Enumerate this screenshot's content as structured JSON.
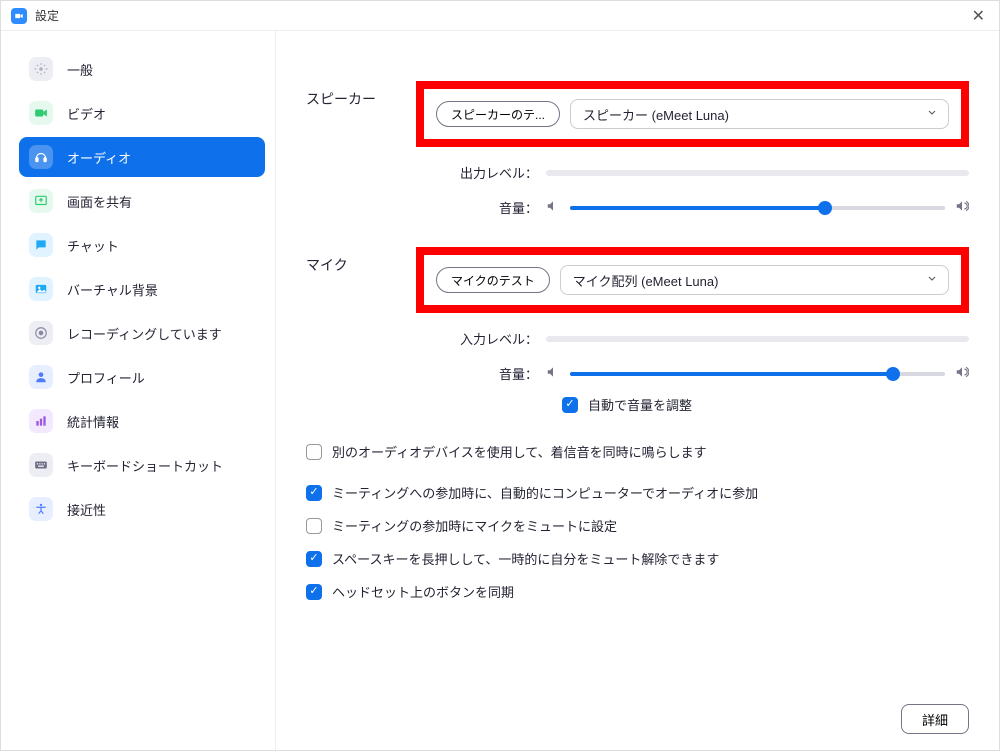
{
  "window": {
    "title": "設定"
  },
  "sidebar": {
    "items": [
      {
        "id": "general",
        "label": "一般",
        "iconBg": "#EDEDF4",
        "iconColor": "#B0B0BE"
      },
      {
        "id": "video",
        "label": "ビデオ",
        "iconBg": "#E6F9EE",
        "iconColor": "#2ECC71"
      },
      {
        "id": "audio",
        "label": "オーディオ",
        "iconBg": "#ffffff",
        "iconColor": "#ffffff",
        "selected": true
      },
      {
        "id": "share",
        "label": "画面を共有",
        "iconBg": "#E6F9EE",
        "iconColor": "#2ECC71"
      },
      {
        "id": "chat",
        "label": "チャット",
        "iconBg": "#E1F3FF",
        "iconColor": "#1FA8F4"
      },
      {
        "id": "vbg",
        "label": "バーチャル背景",
        "iconBg": "#E1F3FF",
        "iconColor": "#1FA8F4"
      },
      {
        "id": "recording",
        "label": "レコーディングしています",
        "iconBg": "#EDEDF4",
        "iconColor": "#8A8AA3"
      },
      {
        "id": "profile",
        "label": "プロフィール",
        "iconBg": "#E7EEFF",
        "iconColor": "#4F7CFF"
      },
      {
        "id": "stats",
        "label": "統計情報",
        "iconBg": "#F2E9FF",
        "iconColor": "#9B59E0"
      },
      {
        "id": "shortcuts",
        "label": "キーボードショートカット",
        "iconBg": "#EDEDF4",
        "iconColor": "#6E6E87"
      },
      {
        "id": "accessibility",
        "label": "接近性",
        "iconBg": "#E7EEFF",
        "iconColor": "#4F7CFF"
      }
    ]
  },
  "audio": {
    "speaker": {
      "sectionLabel": "スピーカー",
      "testBtn": "スピーカーのテ...",
      "device": "スピーカー (eMeet Luna)",
      "outputLevelLabel": "出力レベル：",
      "volumeLabel": "音量：",
      "volumePct": 68
    },
    "mic": {
      "sectionLabel": "マイク",
      "testBtn": "マイクのテスト",
      "device": "マイク配列 (eMeet Luna)",
      "inputLevelLabel": "入力レベル：",
      "volumeLabel": "音量：",
      "volumePct": 86,
      "autoAdjustLabel": "自動で音量を調整",
      "autoAdjustChecked": true
    },
    "options": [
      {
        "checked": false,
        "label": "別のオーディオデバイスを使用して、着信音を同時に鳴らします"
      },
      {
        "checked": true,
        "label": "ミーティングへの参加時に、自動的にコンピューターでオーディオに参加"
      },
      {
        "checked": false,
        "label": "ミーティングの参加時にマイクをミュートに設定"
      },
      {
        "checked": true,
        "label": "スペースキーを長押しして、一時的に自分をミュート解除できます"
      },
      {
        "checked": true,
        "label": "ヘッドセット上のボタンを同期"
      }
    ],
    "advancedBtn": "詳細"
  }
}
